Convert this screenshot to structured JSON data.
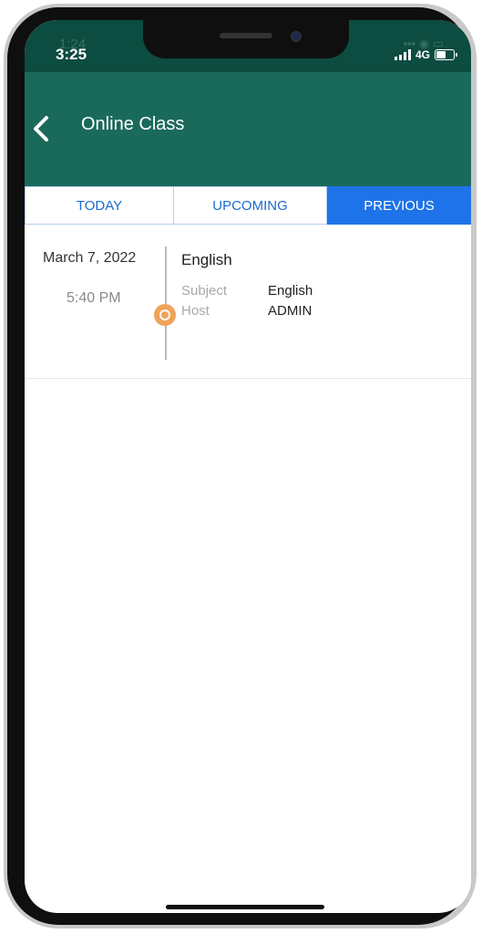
{
  "ghost_status": {
    "time": "1:24"
  },
  "status_bar": {
    "time": "3:25",
    "network": "4G"
  },
  "header": {
    "title": "Online Class"
  },
  "tabs": [
    {
      "label": "TODAY",
      "active": false
    },
    {
      "label": "UPCOMING",
      "active": false
    },
    {
      "label": "PREVIOUS",
      "active": true
    }
  ],
  "classes": [
    {
      "date": "March 7, 2022",
      "time": "5:40 PM",
      "title": "English",
      "subject_label": "Subject",
      "subject_value": "English",
      "host_label": "Host",
      "host_value": "ADMIN"
    }
  ],
  "colors": {
    "header_bg": "#1a6a5b",
    "tab_active": "#1f73e8",
    "timeline_dot": "#f0a259"
  }
}
